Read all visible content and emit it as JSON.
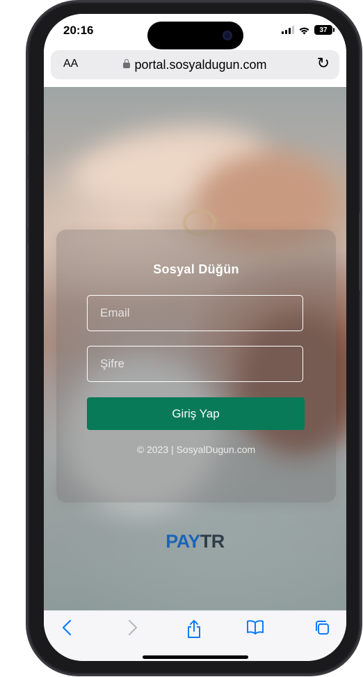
{
  "status": {
    "time": "20:16",
    "battery": "37"
  },
  "browser": {
    "text_size_label": "AA",
    "url": "portal.sosyaldugun.com",
    "reload_icon": "reload-icon"
  },
  "login": {
    "title": "Sosyal Düğün",
    "email_placeholder": "Email",
    "password_placeholder": "Şifre",
    "submit_label": "Giriş Yap",
    "footer": "© 2023  | SosyalDugun.com"
  },
  "brand": {
    "pay": "PAY",
    "tr": "TR",
    "pay_color": "#1d64b8",
    "tr_color": "#2f3d4a",
    "button_color": "#087a58"
  },
  "toolbar": {
    "back_icon": "chevron-left-icon",
    "forward_icon": "chevron-right-icon",
    "share_icon": "share-icon",
    "bookmarks_icon": "book-icon",
    "tabs_icon": "tabs-icon"
  }
}
